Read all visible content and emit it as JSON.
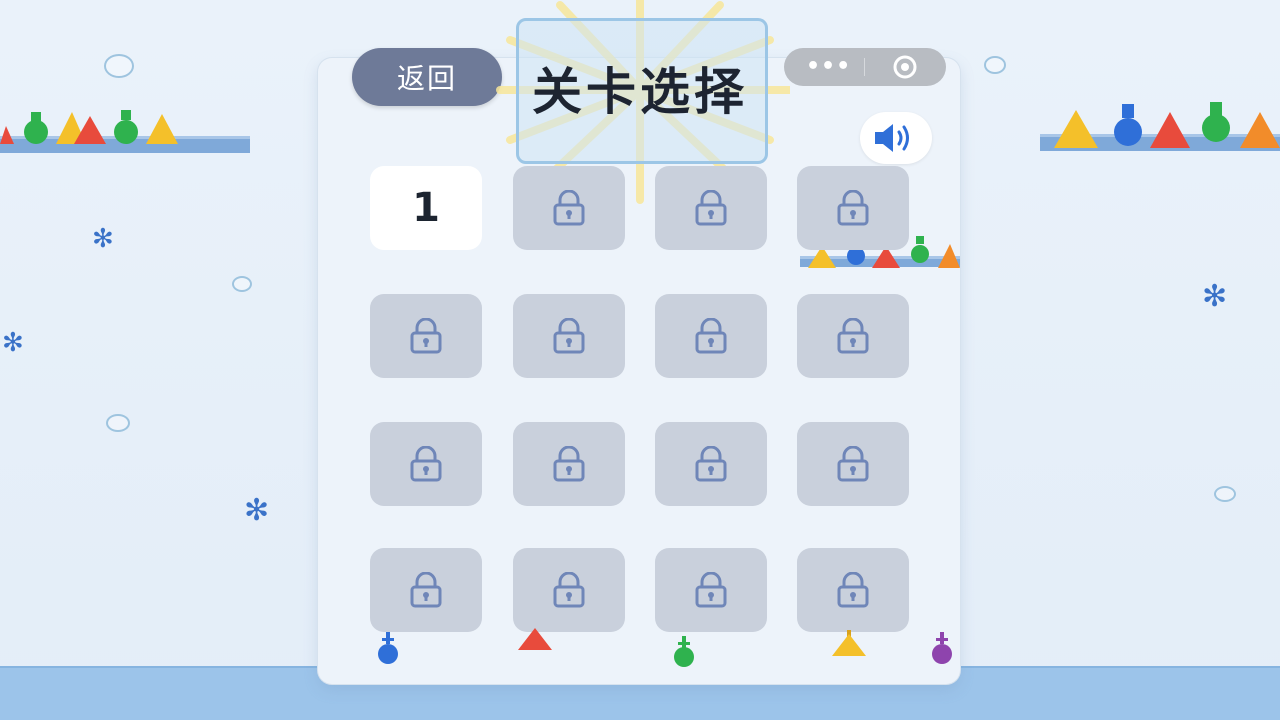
{
  "header": {
    "back_label": "返回",
    "title": "关卡选择"
  },
  "capsule": {
    "menu_icon": "more-dots-icon",
    "close_icon": "target-circle-icon"
  },
  "sound": {
    "icon": "speaker-on-icon"
  },
  "levels": [
    {
      "number": "1",
      "locked": false
    },
    {
      "number": "",
      "locked": true
    },
    {
      "number": "",
      "locked": true
    },
    {
      "number": "",
      "locked": true
    },
    {
      "number": "",
      "locked": true
    },
    {
      "number": "",
      "locked": true
    },
    {
      "number": "",
      "locked": true
    },
    {
      "number": "",
      "locked": true
    },
    {
      "number": "",
      "locked": true
    },
    {
      "number": "",
      "locked": true
    },
    {
      "number": "",
      "locked": true
    },
    {
      "number": "",
      "locked": true
    },
    {
      "number": "",
      "locked": true
    },
    {
      "number": "",
      "locked": true
    },
    {
      "number": "",
      "locked": true
    },
    {
      "number": "",
      "locked": true
    }
  ],
  "colors": {
    "back_button": "#6e7a98",
    "tile_locked": "#c9d0dc",
    "tile_open": "#ffffff",
    "lock_icon": "#6f86b8",
    "speaker": "#2f6fd8"
  }
}
